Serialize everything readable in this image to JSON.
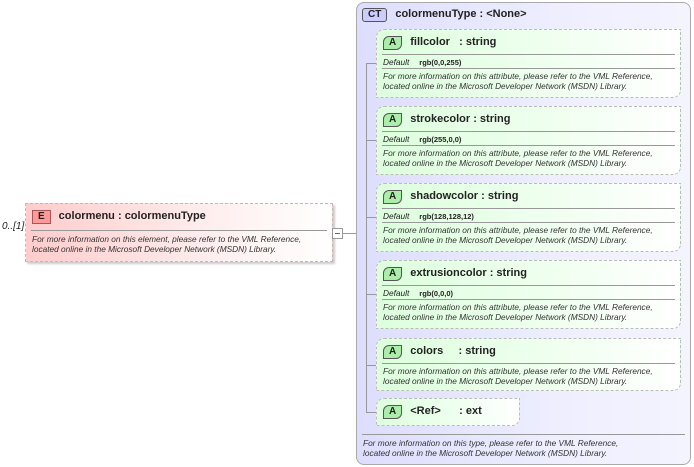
{
  "element": {
    "occurrence": "0..[1]",
    "badge": "E",
    "name": "colormenu",
    "type": "colormenuType",
    "doc1": "For more information on this element, please refer to the VML Reference,",
    "doc2": "located online in the Microsoft Developer Network (MSDN) Library."
  },
  "complex_type": {
    "badge": "CT",
    "title": "colormenuType : <None>",
    "doc1": "For more information on this type, please refer to the VML Reference,",
    "doc2": "located online in the Microsoft Developer Network (MSDN) Library."
  },
  "attributes": [
    {
      "badge": "A",
      "title": "fillcolor   : string",
      "default_label": "Default",
      "default": "rgb(0,0,255)",
      "doc1": "For more information on this attribute, please refer to the VML Reference,",
      "doc2": "located online in the Microsoft Developer Network (MSDN) Library."
    },
    {
      "badge": "A",
      "title": "strokecolor : string",
      "default_label": "Default",
      "default": "rgb(255,0,0)",
      "doc1": "For more information on this attribute, please refer to the VML Reference,",
      "doc2": "located online in the Microsoft Developer Network (MSDN) Library."
    },
    {
      "badge": "A",
      "title": "shadowcolor : string",
      "default_label": "Default",
      "default": "rgb(128,128,12)",
      "doc1": "For more information on this attribute, please refer to the VML Reference,",
      "doc2": "located online in the Microsoft Developer Network (MSDN) Library."
    },
    {
      "badge": "A",
      "title": "extrusioncolor : string",
      "default_label": "Default",
      "default": "rgb(0,0,0)",
      "doc1": "For more information on this attribute, please refer to the VML Reference,",
      "doc2": "located online in the Microsoft Developer Network (MSDN) Library."
    },
    {
      "badge": "A",
      "title": "colors     : string",
      "doc1": "For more information on this attribute, please refer to the VML Reference,",
      "doc2": "located online in the Microsoft Developer Network (MSDN) Library."
    },
    {
      "badge": "A",
      "title": "<Ref>      : ext"
    }
  ]
}
